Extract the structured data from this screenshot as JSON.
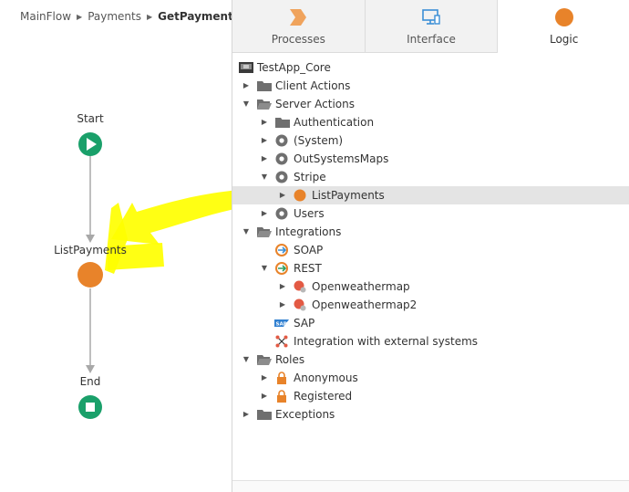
{
  "breadcrumb": {
    "items": [
      "MainFlow",
      "Payments",
      "GetPayments"
    ]
  },
  "flow": {
    "start_label": "Start",
    "action_label": "ListPayments",
    "end_label": "End",
    "start_color": "#1aa06a",
    "action_color": "#e8832a",
    "end_color": "#1aa06a",
    "highlight_color": "#ffff00"
  },
  "tabs": [
    {
      "label": "Processes",
      "icon": "process-chevron-icon"
    },
    {
      "label": "Interface",
      "icon": "monitor-icon"
    },
    {
      "label": "Logic",
      "icon": "logic-circle-icon",
      "active": true
    }
  ],
  "tree": {
    "items": [
      {
        "label": "TestApp_Core",
        "icon": "module-icon",
        "depth": 0,
        "arrow": ""
      },
      {
        "label": "Client Actions",
        "icon": "folder-icon",
        "depth": 1,
        "arrow": "right"
      },
      {
        "label": "Server Actions",
        "icon": "folder-open-icon",
        "depth": 1,
        "arrow": "down"
      },
      {
        "label": "Authentication",
        "icon": "folder-icon",
        "depth": 2,
        "arrow": "right"
      },
      {
        "label": "(System)",
        "icon": "dependency-icon",
        "depth": 2,
        "arrow": "right"
      },
      {
        "label": "OutSystemsMaps",
        "icon": "dependency-icon",
        "depth": 2,
        "arrow": "right"
      },
      {
        "label": "Stripe",
        "icon": "dependency-icon",
        "depth": 2,
        "arrow": "down"
      },
      {
        "label": "ListPayments",
        "icon": "action-icon",
        "depth": 3,
        "arrow": "right",
        "selected": true
      },
      {
        "label": "Users",
        "icon": "dependency-icon",
        "depth": 2,
        "arrow": "right"
      },
      {
        "label": "Integrations",
        "icon": "folder-open-icon",
        "depth": 1,
        "arrow": "down"
      },
      {
        "label": "SOAP",
        "icon": "soap-icon",
        "depth": 2,
        "arrow": ""
      },
      {
        "label": "REST",
        "icon": "rest-icon",
        "depth": 2,
        "arrow": "down"
      },
      {
        "label": "Openweathermap",
        "icon": "rest-api-icon",
        "depth": 3,
        "arrow": "right"
      },
      {
        "label": "Openweathermap2",
        "icon": "rest-api-icon",
        "depth": 3,
        "arrow": "right"
      },
      {
        "label": "SAP",
        "icon": "sap-icon",
        "depth": 2,
        "arrow": ""
      },
      {
        "label": "Integration with external systems",
        "icon": "integration-icon",
        "depth": 2,
        "arrow": ""
      },
      {
        "label": "Roles",
        "icon": "folder-open-icon",
        "depth": 1,
        "arrow": "down"
      },
      {
        "label": "Anonymous",
        "icon": "lock-icon",
        "depth": 2,
        "arrow": "right"
      },
      {
        "label": "Registered",
        "icon": "lock-icon",
        "depth": 2,
        "arrow": "right"
      },
      {
        "label": "Exceptions",
        "icon": "folder-icon",
        "depth": 1,
        "arrow": "right"
      }
    ]
  },
  "colors": {
    "accent_orange": "#e8832a",
    "folder_gray": "#6f6f6f",
    "selected_row": "#e4e4e4",
    "tab_bar": "#f2f2f2",
    "interface_blue": "#3b8fd6"
  }
}
